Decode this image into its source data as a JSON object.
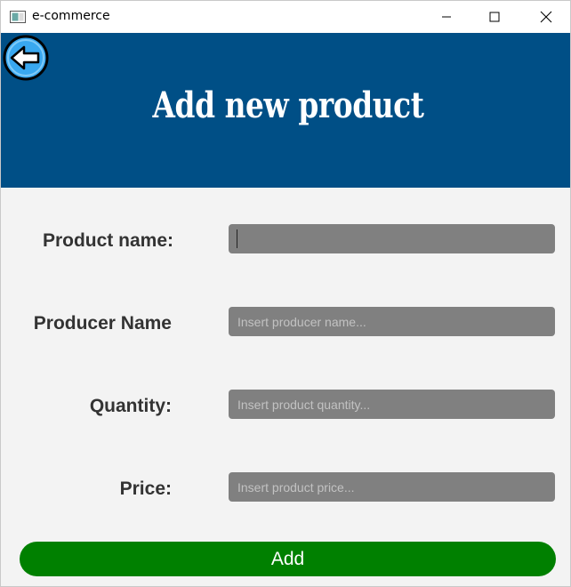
{
  "window": {
    "title": "e-commerce"
  },
  "header": {
    "title": "Add new product",
    "background": "#004f86"
  },
  "form": {
    "fields": [
      {
        "label": "Product name:",
        "value": "",
        "placeholder": ""
      },
      {
        "label": "Producer Name",
        "value": "",
        "placeholder": "Insert producer name..."
      },
      {
        "label": "Quantity:",
        "value": "",
        "placeholder": "Insert product quantity..."
      },
      {
        "label": "Price:",
        "value": "",
        "placeholder": "Insert product price..."
      }
    ],
    "submit_label": "Add",
    "submit_color": "#008000"
  }
}
